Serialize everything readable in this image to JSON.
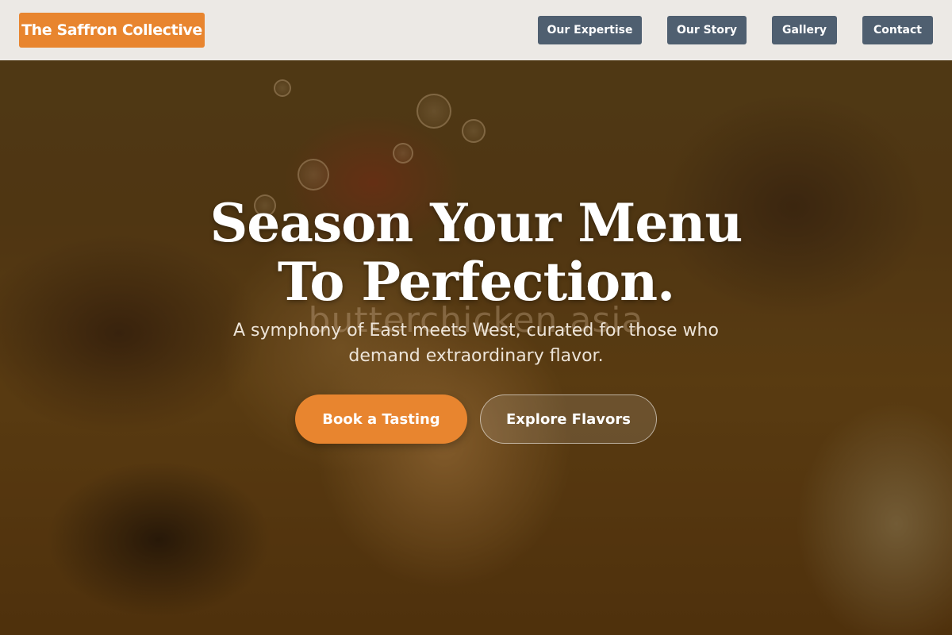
{
  "brand": {
    "name": "The Saffron Collective"
  },
  "nav": {
    "expertise": "Our Expertise",
    "story": "Our Story",
    "gallery": "Gallery",
    "contact": "Contact"
  },
  "hero": {
    "headline_line1": "Season Your Menu",
    "headline_line2": "To Perfection.",
    "subheadline_line1": "A symphony of East meets West, curated for those who",
    "subheadline_line2": "demand extraordinary flavor.",
    "watermark": "butterchicken.asia",
    "primary_cta": "Book a Tasting",
    "secondary_cta": "Explore Flavors"
  },
  "colors": {
    "accent": "#e8852f",
    "nav_button": "#4f5f70",
    "header_bg": "#f2f0ee"
  }
}
